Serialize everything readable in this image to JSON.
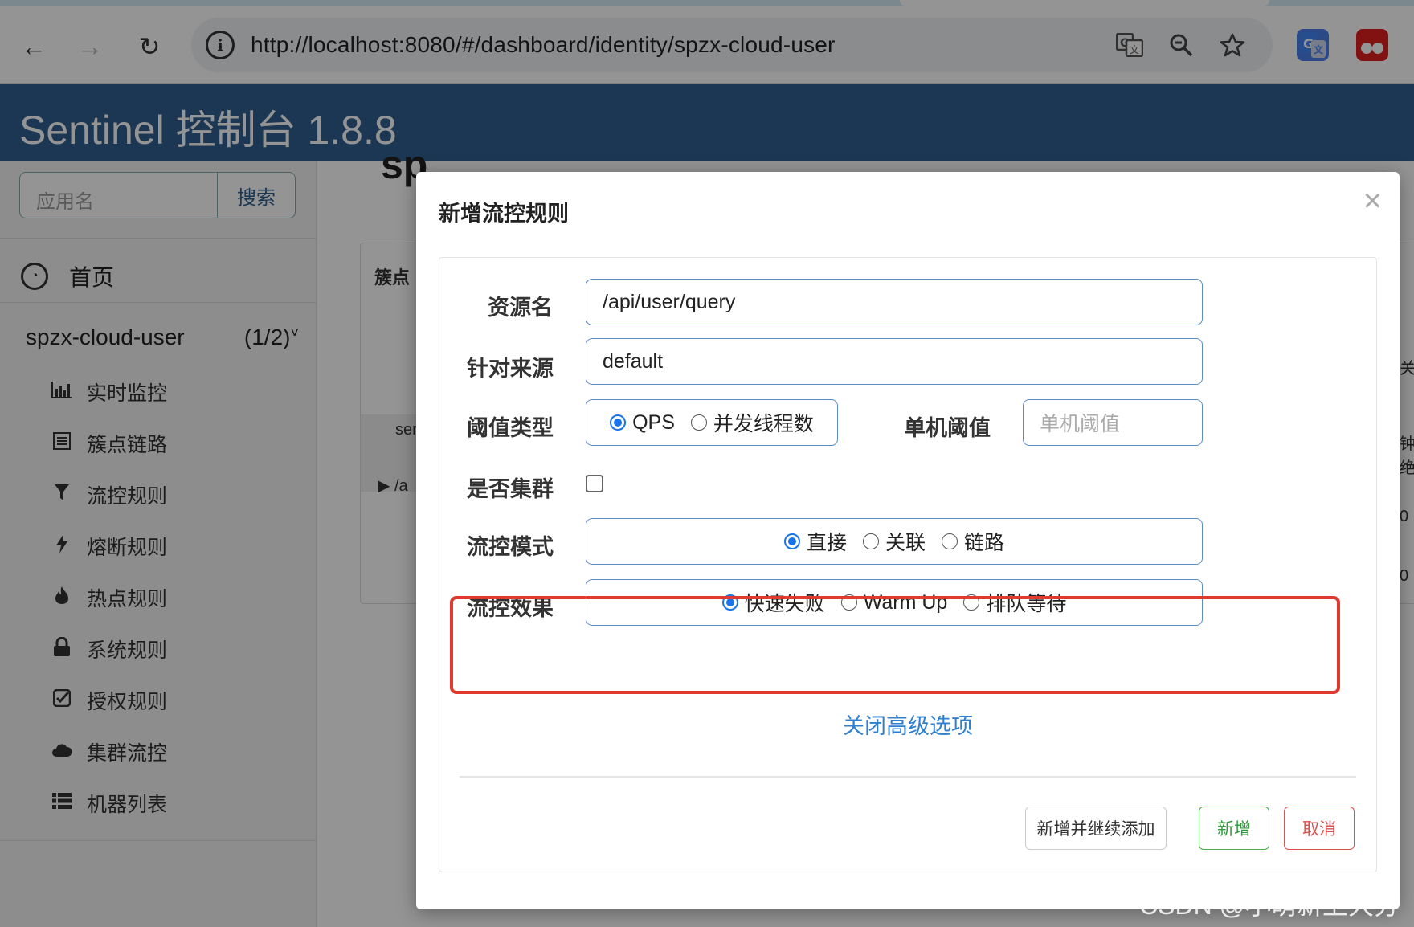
{
  "browser": {
    "url": "http://localhost:8080/#/dashboard/identity/spzx-cloud-user",
    "back_icon": "←",
    "forward_icon": "→",
    "reload_icon": "↻",
    "info_icon": "i"
  },
  "app": {
    "title": "Sentinel 控制台 1.8.8"
  },
  "sidebar": {
    "search_placeholder": "应用名",
    "search_button": "搜索",
    "home": "首页",
    "app_name": "spzx-cloud-user",
    "app_count": "(1/2)",
    "items": [
      {
        "label": "实时监控",
        "icon": "chart-icon"
      },
      {
        "label": "簇点链路",
        "icon": "list-icon"
      },
      {
        "label": "流控规则",
        "icon": "filter-icon"
      },
      {
        "label": "熔断规则",
        "icon": "bolt-icon"
      },
      {
        "label": "热点规则",
        "icon": "fire-icon"
      },
      {
        "label": "系统规则",
        "icon": "lock-icon"
      },
      {
        "label": "授权规则",
        "icon": "check-icon"
      },
      {
        "label": "集群流控",
        "icon": "cloud-icon"
      },
      {
        "label": "机器列表",
        "icon": "table-icon"
      }
    ]
  },
  "background": {
    "heading": "sp",
    "table_header": "簇点",
    "row1": "ser",
    "row2": "▶  /a",
    "right_header": "关",
    "right_mid1": "钟",
    "right_mid2": "绝",
    "right_val1": "0",
    "right_val2": "0"
  },
  "modal": {
    "title": "新增流控规则",
    "close": "×",
    "resource_label": "资源名",
    "resource_value": "/api/user/query",
    "origin_label": "针对来源",
    "origin_value": "default",
    "threshold_type_label": "阈值类型",
    "threshold_type_options": [
      "QPS",
      "并发线程数"
    ],
    "threshold_type_selected": "QPS",
    "single_threshold_label": "单机阈值",
    "single_threshold_placeholder": "单机阈值",
    "cluster_label": "是否集群",
    "cluster_checked": false,
    "mode_label": "流控模式",
    "mode_options": [
      "直接",
      "关联",
      "链路"
    ],
    "mode_selected": "直接",
    "effect_label": "流控效果",
    "effect_options": [
      "快速失败",
      "Warm Up",
      "排队等待"
    ],
    "effect_selected": "快速失败",
    "advanced_toggle": "关闭高级选项",
    "buttons": {
      "add_continue": "新增并继续添加",
      "add": "新增",
      "cancel": "取消"
    },
    "highlight_color": "#e03a2e"
  },
  "watermark": "CSDN @小萌新上大分"
}
